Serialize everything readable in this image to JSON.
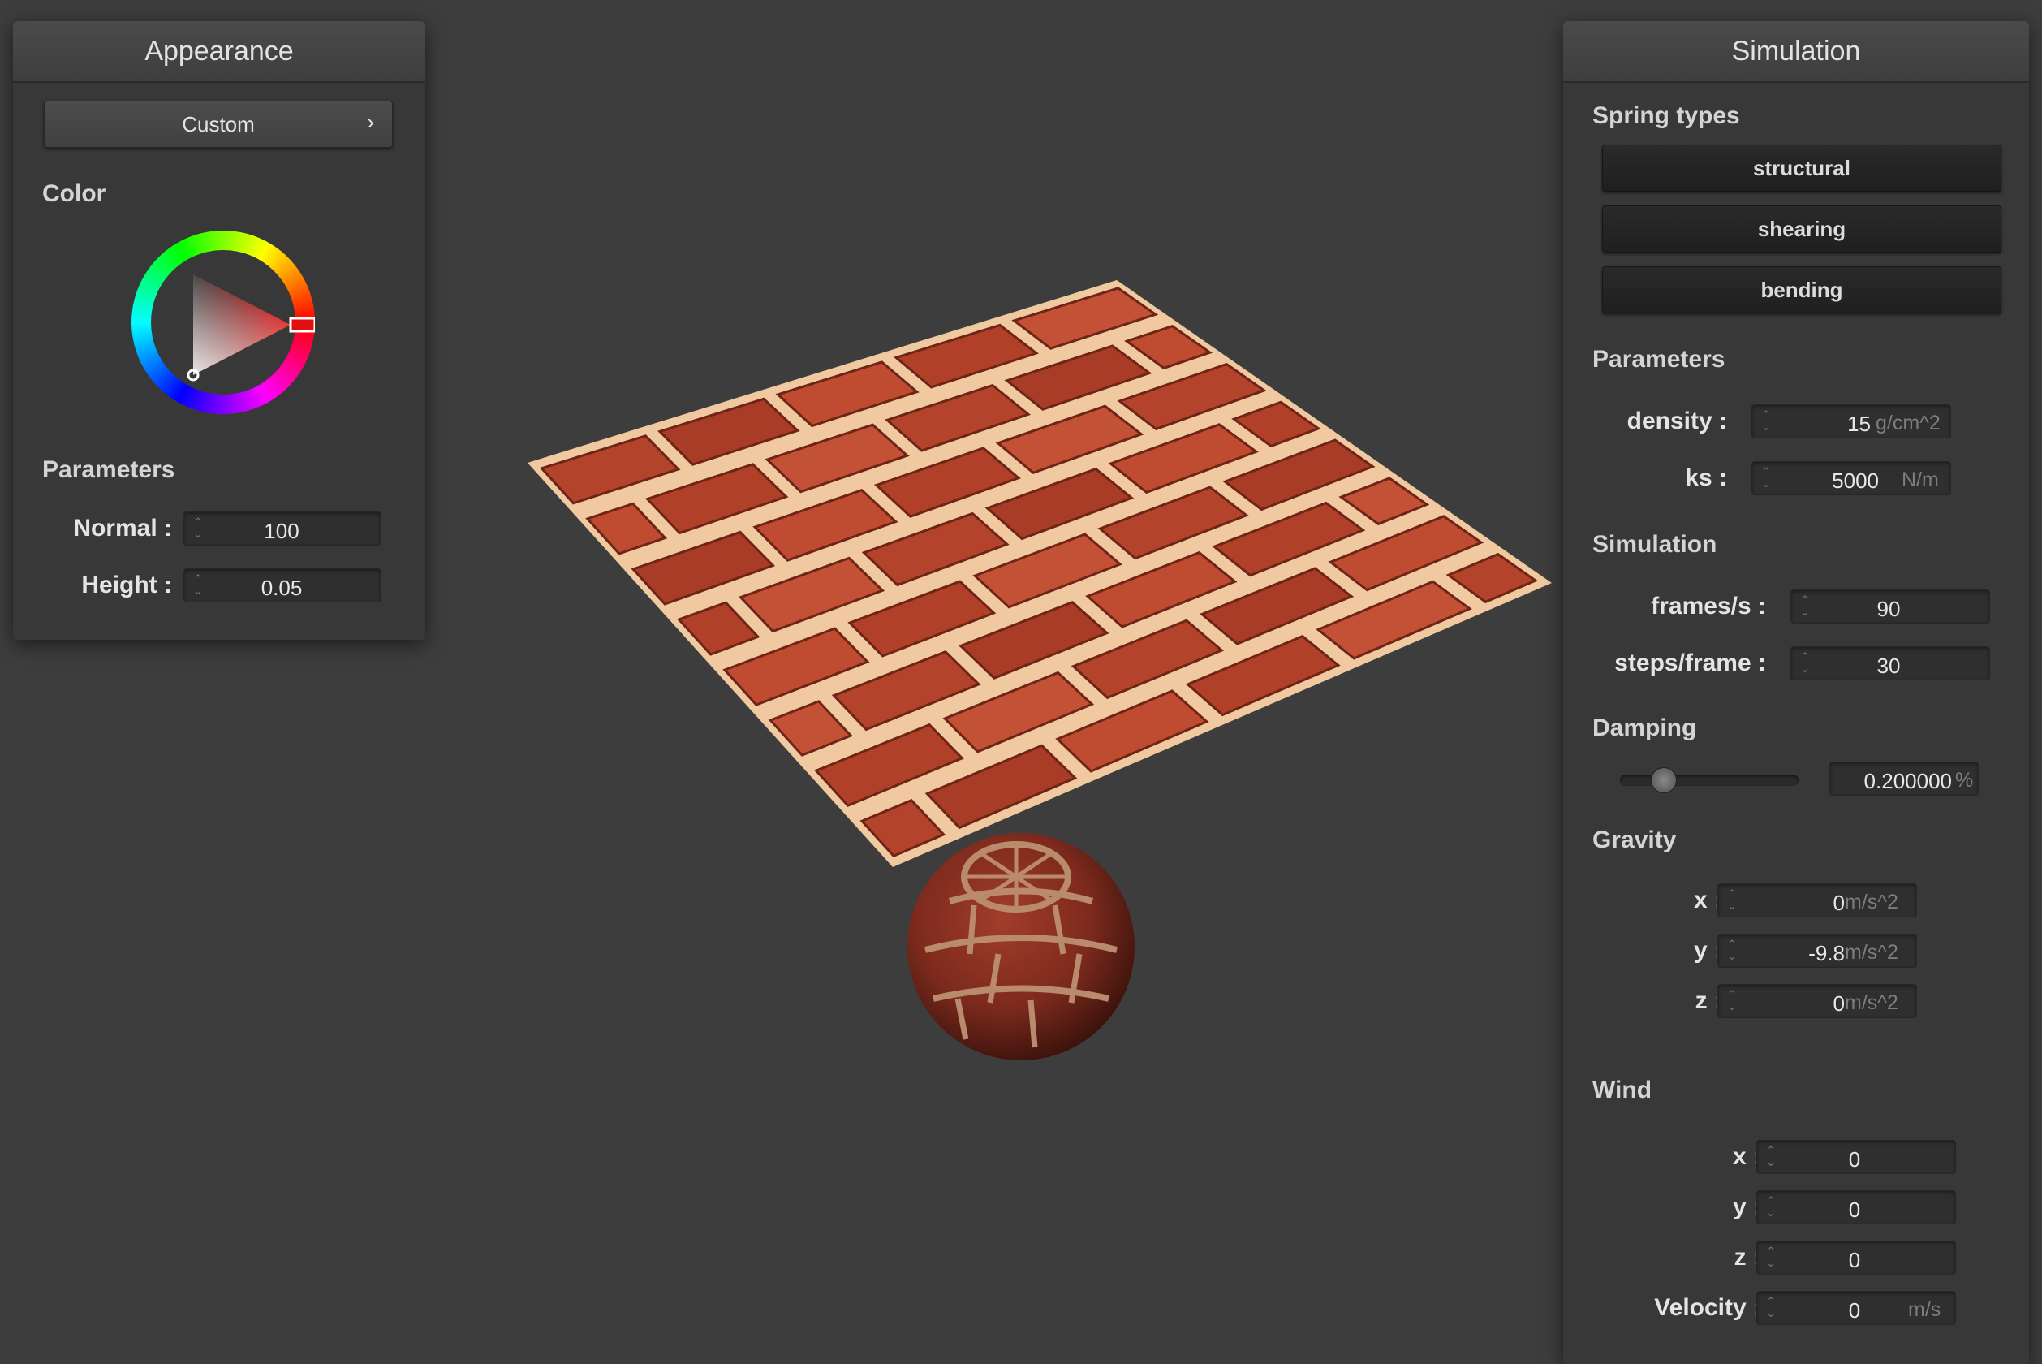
{
  "appearance": {
    "title": "Appearance",
    "preset": "Custom",
    "preset_chevron": "›",
    "color_label": "Color",
    "color_value": "#e01010",
    "parameters_label": "Parameters",
    "normal_label": "Normal :",
    "normal_value": "100",
    "height_label": "Height :",
    "height_value": "0.05"
  },
  "simulation": {
    "title": "Simulation",
    "spring_types_label": "Spring types",
    "springs": [
      "structural",
      "shearing",
      "bending"
    ],
    "parameters_label": "Parameters",
    "density_label": "density :",
    "density_value": "15",
    "density_unit": "g/cm^2",
    "ks_label": "ks :",
    "ks_value": "5000",
    "ks_unit": "N/m",
    "simulation_label": "Simulation",
    "fps_label": "frames/s :",
    "fps_value": "90",
    "steps_label": "steps/frame :",
    "steps_value": "30",
    "damping_label": "Damping",
    "damping_value": "0.200000",
    "damping_unit": "%",
    "damping_fraction": 0.2,
    "gravity_label": "Gravity",
    "gravity": {
      "x_label": "x :",
      "x_value": "0",
      "y_label": "y :",
      "y_value": "-9.8",
      "z_label": "z :",
      "z_value": "0",
      "unit": "m/s^2"
    },
    "wind_label": "Wind",
    "wind": {
      "x_label": "x :",
      "x_value": "0",
      "y_label": "y :",
      "y_value": "0",
      "z_label": "z :",
      "z_value": "0",
      "velocity_label": "Velocity :",
      "velocity_value": "0",
      "velocity_unit": "m/s"
    }
  },
  "colors": {
    "background": "#3d3d3d",
    "brick": "#b5412b",
    "mortar": "#f0c9a0"
  }
}
